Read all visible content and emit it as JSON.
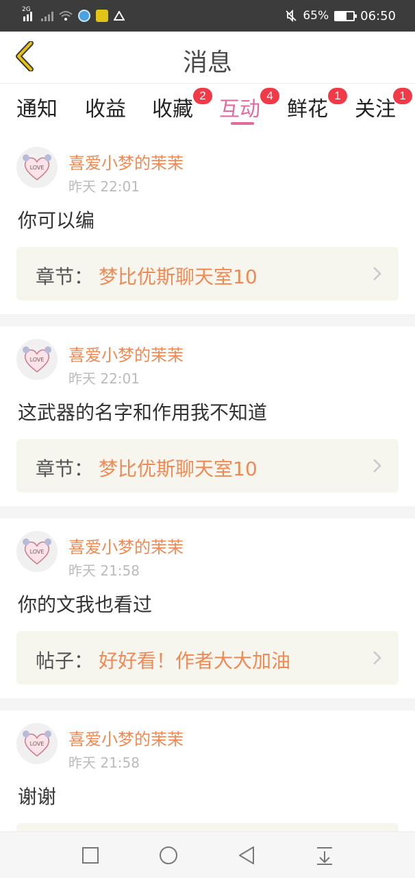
{
  "status_bar": {
    "network_label": "2G",
    "battery": "65%",
    "time": "06:50",
    "icons": [
      "signal-icon",
      "signal-x-icon",
      "wifi-icon",
      "app-icon",
      "app-icon",
      "alert-triangle-icon",
      "mute-icon",
      "battery-icon"
    ]
  },
  "header": {
    "title": "消息",
    "back_icon": "chevron-left-icon"
  },
  "tabs": [
    {
      "label": "通知",
      "badge": ""
    },
    {
      "label": "收益",
      "badge": ""
    },
    {
      "label": "收藏",
      "badge": "2"
    },
    {
      "label": "互动",
      "badge": "4",
      "active": true
    },
    {
      "label": "鲜花",
      "badge": "1"
    },
    {
      "label": "关注",
      "badge": "1"
    }
  ],
  "messages": [
    {
      "author": "喜爱小梦的茉茉",
      "time": "昨天 22:01",
      "text": "你可以编",
      "ref_label": "章节：",
      "ref_title": "梦比优斯聊天室10"
    },
    {
      "author": "喜爱小梦的茉茉",
      "time": "昨天 22:01",
      "text": "这武器的名字和作用我不知道",
      "ref_label": "章节：",
      "ref_title": "梦比优斯聊天室10"
    },
    {
      "author": "喜爱小梦的茉茉",
      "time": "昨天 21:58",
      "text": "你的文我也看过",
      "ref_label": "帖子：",
      "ref_title": "好好看！作者大大加油"
    },
    {
      "author": "喜爱小梦的茉茉",
      "time": "昨天 21:58",
      "text": "谢谢",
      "ref_label": "",
      "ref_title": ""
    }
  ],
  "nav": [
    "square-icon",
    "circle-icon",
    "triangle-back-icon",
    "download-icon"
  ],
  "colors": {
    "accent": "#e26aa0",
    "author": "#ee8a55",
    "badge": "#f03a47",
    "back_arrow": "#c9a50a"
  }
}
